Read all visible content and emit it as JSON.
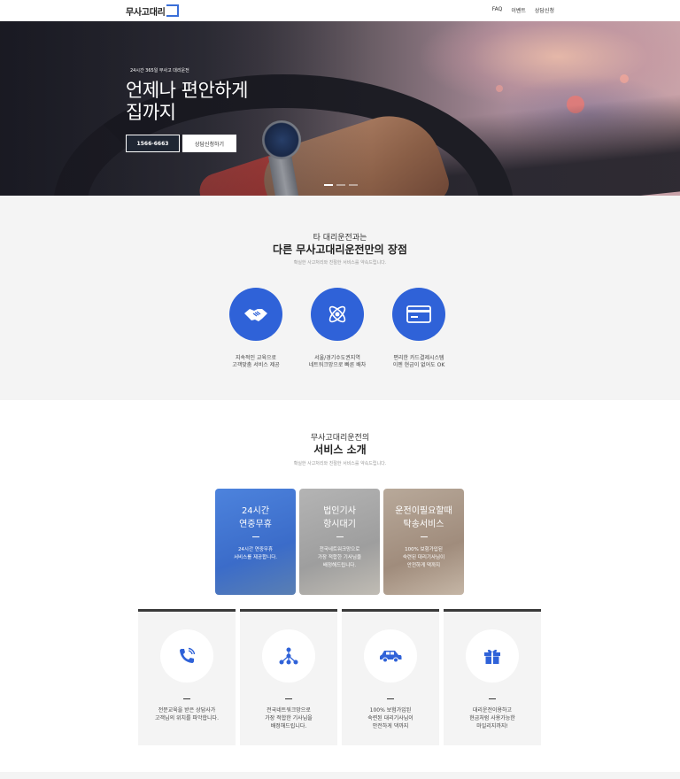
{
  "header": {
    "logo_text": "무사고대리",
    "nav": [
      "FAQ",
      "이벤트",
      "상담신청"
    ]
  },
  "hero": {
    "subtitle": "24시간 365일 무사고 대리운전",
    "title_line1": "언제나 편안하게",
    "title_line2": "집까지",
    "phone_button": "1566-6663",
    "consult_button": "상담신청하기"
  },
  "features": {
    "title_small": "타 대리운전과는",
    "title_big": "다른 무사고대리운전만의 장점",
    "desc": "확실한 사고처리와 친절한 서비스를 약속드립니다.",
    "items": [
      {
        "icon": "handshake-icon",
        "line1": "지속적인 교육으로",
        "line2": "고객맞춤 서비스 제공"
      },
      {
        "icon": "atom-icon",
        "line1": "서울/경기수도권지역",
        "line2": "네트워크망으로 빠른 배차"
      },
      {
        "icon": "credit-card-icon",
        "line1": "편리한 카드결제시스템",
        "line2": "이젠 현금이 없어도 OK"
      }
    ]
  },
  "services": {
    "title_small": "무사고대리운전의",
    "title_big": "서비스 소개",
    "desc": "확실한 사고처리와 친절한 서비스를 약속드립니다.",
    "cards": [
      {
        "t1": "24시간",
        "t2": "연중무휴",
        "d1": "24시간 연중무휴",
        "d2": "서비스를 제공합니다."
      },
      {
        "t1": "법인기사",
        "t2": "항시대기",
        "d1": "전국네트워크망으로",
        "d2": "가장 적합한 기사님을",
        "d3": "배정해드립니다."
      },
      {
        "t1": "운전이필요할때",
        "t2": "탁송서비스",
        "d1": "100% 보험가입된",
        "d2": "숙련된 대리기사님이",
        "d3": "안전하게 댁까지"
      }
    ],
    "boxes": [
      {
        "icon": "phone-icon",
        "l1": "전문교육을 받은 상담사가",
        "l2": "고객님의 위치를 파악합니다."
      },
      {
        "icon": "network-icon",
        "l1": "전국네트워크망으로",
        "l2": "가장 적합한 기사님을",
        "l3": "배정해드립니다."
      },
      {
        "icon": "car-icon",
        "l1": "100% 보험가입된",
        "l2": "숙련된 대리기사님이",
        "l3": "안전하게 댁까지"
      },
      {
        "icon": "gift-icon",
        "l1": "대리운전이용하고",
        "l2": "현금처럼 사용가능한",
        "l3": "마일리지까지!"
      }
    ]
  },
  "colors": {
    "accent": "#2f62d8",
    "dark": "#1f2633"
  }
}
